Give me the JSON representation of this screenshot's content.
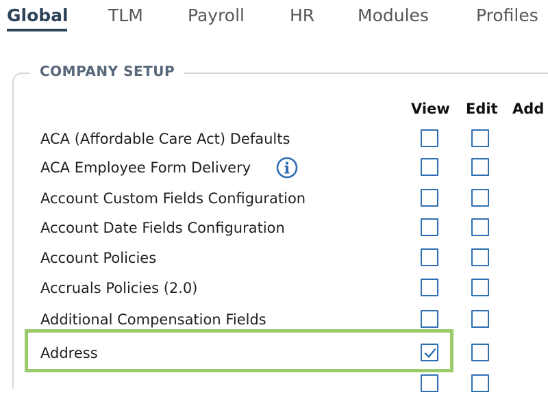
{
  "tabs": [
    {
      "label": "Global",
      "active": true
    },
    {
      "label": "TLM",
      "active": false
    },
    {
      "label": "Payroll",
      "active": false
    },
    {
      "label": "HR",
      "active": false
    },
    {
      "label": "Modules",
      "active": false
    },
    {
      "label": "Profiles",
      "active": false
    }
  ],
  "section": {
    "title": "COMPANY SETUP",
    "columns": {
      "view": "View",
      "edit": "Edit",
      "add": "Add"
    },
    "rows": [
      {
        "label": "ACA (Affordable Care Act) Defaults",
        "view": false,
        "edit": false,
        "info_icon": false
      },
      {
        "label": "ACA Employee Form Delivery",
        "view": false,
        "edit": false,
        "info_icon": true
      },
      {
        "label": "Account Custom Fields Configuration",
        "view": false,
        "edit": false,
        "info_icon": false
      },
      {
        "label": "Account Date Fields Configuration",
        "view": false,
        "edit": false,
        "info_icon": false
      },
      {
        "label": "Account Policies",
        "view": false,
        "edit": false,
        "info_icon": false
      },
      {
        "label": "Accruals Policies (2.0)",
        "view": false,
        "edit": false,
        "info_icon": false
      },
      {
        "label": "Additional Compensation Fields",
        "view": false,
        "edit": false,
        "info_icon": false
      },
      {
        "label": "Address",
        "view": true,
        "edit": false,
        "info_icon": false,
        "highlighted": true
      }
    ]
  },
  "colors": {
    "accent": "#2c4359",
    "checkbox_border": "#2e6fb3",
    "highlight": "#9acb6a",
    "legend_text": "#58677a"
  },
  "icons": {
    "info": "info-circle-icon",
    "check": "check-icon"
  }
}
